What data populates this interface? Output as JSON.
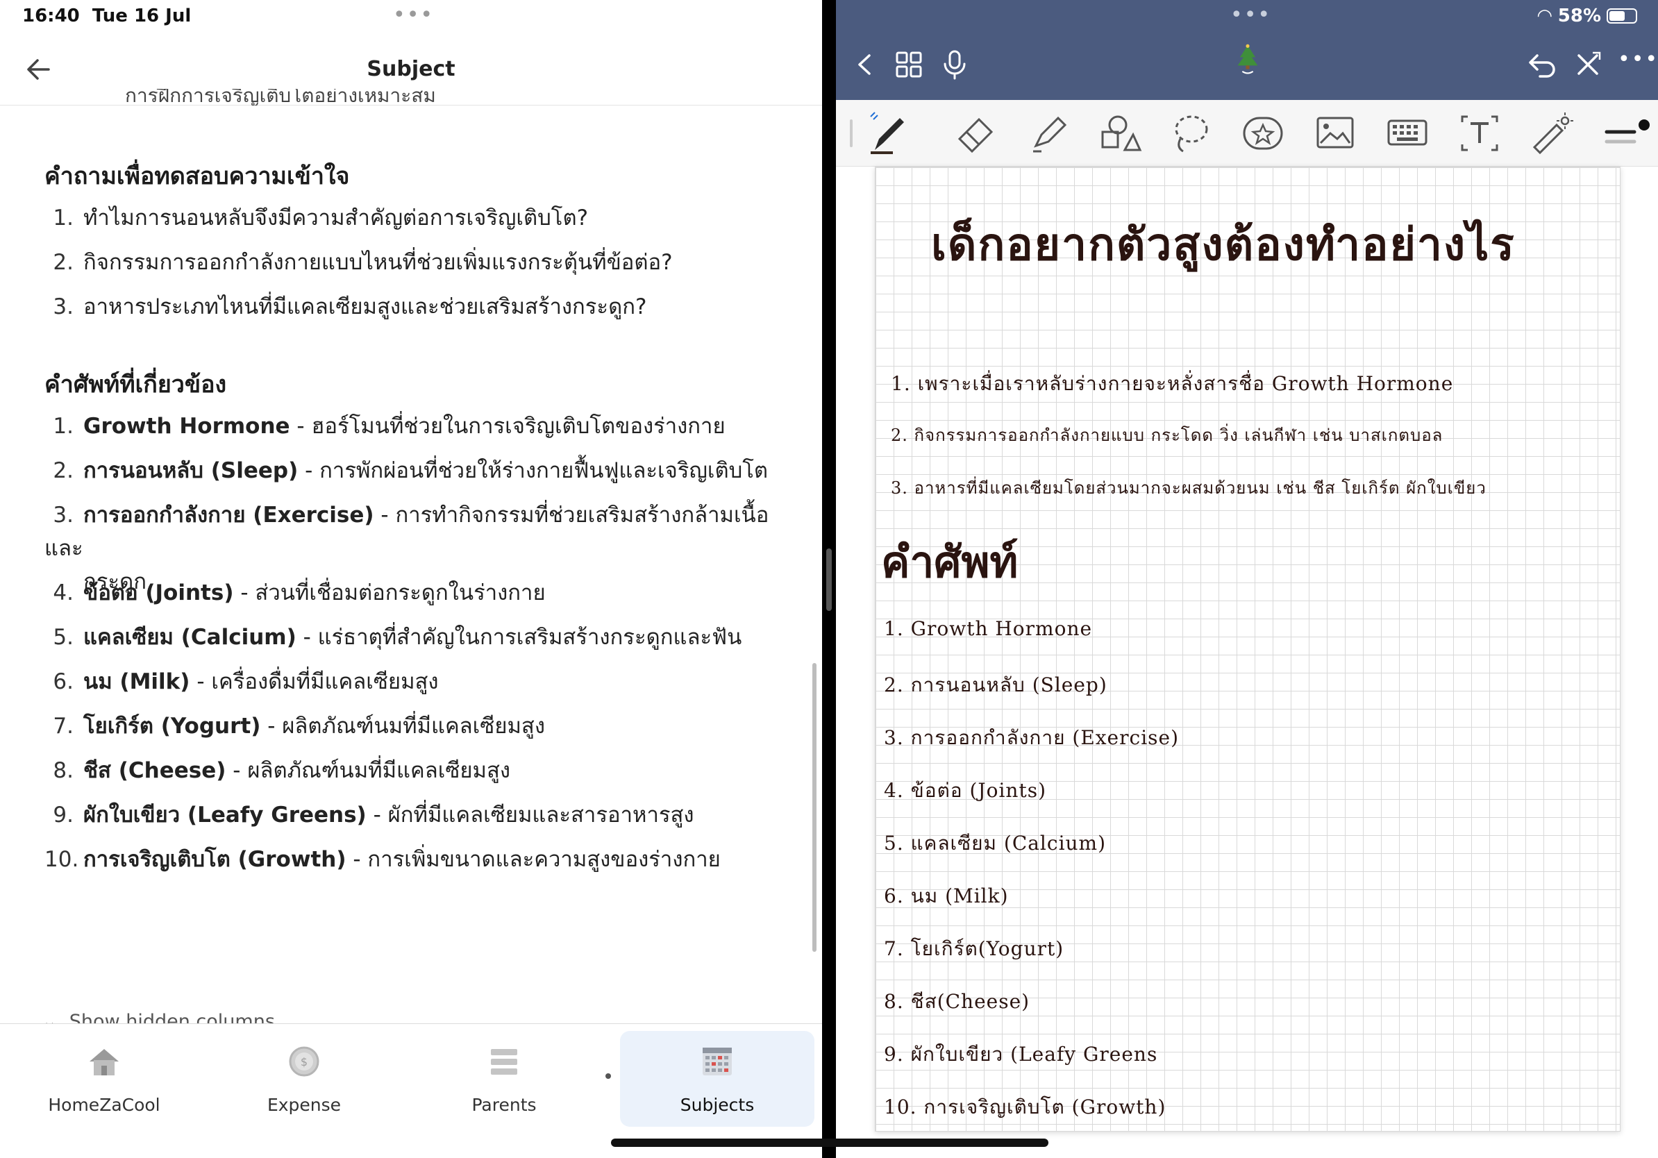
{
  "status": {
    "time": "16:40",
    "date": "Tue 16 Jul",
    "battery": "58%"
  },
  "left": {
    "header_title": "Subject",
    "cutoff_text": "การฝึกการเจริญเติบโตอย่างเหมาะสม",
    "questions_title": "คำถามเพื่อทดสอบความเข้าใจ",
    "questions": [
      {
        "num": "1.",
        "text": "ทำไมการนอนหลับจึงมีความสำคัญต่อการเจริญเติบโต?"
      },
      {
        "num": "2.",
        "text": "กิจกรรมการออกกำลังกายแบบไหนที่ช่วยเพิ่มแรงกระตุ้นที่ข้อต่อ?"
      },
      {
        "num": "3.",
        "text": "อาหารประเภทไหนที่มีแคลเซียมสูงและช่วยเสริมสร้างกระดูก?"
      }
    ],
    "terms_title": "คำศัพท์ที่เกี่ยวข้อง",
    "terms": [
      {
        "num": "1.",
        "term": "Growth Hormone",
        "desc": " - ฮอร์โมนที่ช่วยในการเจริญเติบโตของร่างกาย"
      },
      {
        "num": "2.",
        "term": "การนอนหลับ (Sleep)",
        "desc": " - การพักผ่อนที่ช่วยให้ร่างกายฟื้นฟูและเจริญเติบโต"
      },
      {
        "num": "3.",
        "term": "การออกกำลังกาย (Exercise)",
        "desc": " - การทำกิจกรรมที่ช่วยเสริมสร้างกล้ามเนื้อและ",
        "wrap": "กระดูก"
      },
      {
        "num": "4.",
        "term": "ข้อต่อ (Joints)",
        "desc": " - ส่วนที่เชื่อมต่อกระดูกในร่างกาย"
      },
      {
        "num": "5.",
        "term": "แคลเซียม (Calcium)",
        "desc": " - แร่ธาตุที่สำคัญในการเสริมสร้างกระดูกและฟัน"
      },
      {
        "num": "6.",
        "term": "นม (Milk)",
        "desc": " - เครื่องดื่มที่มีแคลเซียมสูง"
      },
      {
        "num": "7.",
        "term": "โยเกิร์ต (Yogurt)",
        "desc": " - ผลิตภัณฑ์นมที่มีแคลเซียมสูง"
      },
      {
        "num": "8.",
        "term": "ชีส (Cheese)",
        "desc": " - ผลิตภัณฑ์นมที่มีแคลเซียมสูง"
      },
      {
        "num": "9.",
        "term": "ผักใบเขียว (Leafy Greens)",
        "desc": " - ผักที่มีแคลเซียมและสารอาหารสูง"
      },
      {
        "num": "10.",
        "term": "การเจริญเติบโต (Growth)",
        "desc": " - การเพิ่มขนาดและความสูงของร่างกาย"
      }
    ],
    "show_hidden": "Show hidden columns",
    "tabs": [
      {
        "label": "HomeZaCool",
        "icon": "home-icon"
      },
      {
        "label": "Expense",
        "icon": "coin-icon"
      },
      {
        "label": "Parents",
        "icon": "list-icon"
      },
      {
        "label": "Subjects",
        "icon": "grid-calendar-icon"
      }
    ]
  },
  "right": {
    "title": "เด็กอยากตัวสูงต้องทำอย่างไร",
    "answers": [
      "1. เพราะเมื่อเราหลับร่างกายจะหลั่งสารชื่อ Growth Hormone",
      "2. กิจกรรมการออกกำลังกายแบบ  กระโดด  วิ่ง   เล่นกีฬา  เช่น  บาสเกตบอล",
      "3. อาหารที่มีแคลเซียมโดยส่วนมากจะผสมด้วยนม  เช่น  ชีส  โยเกิร์ต  ผักใบเขียว"
    ],
    "terms_heading": "คำศัพท์",
    "terms": [
      "1. Growth   Hormone",
      "2. การนอนหลับ (Sleep)",
      "3. การออกกำลังกาย (Exercise)",
      "4. ข้อต่อ (Joints)",
      "5. แคลเซียม (Calcium)",
      "6. นม (Milk)",
      "7. โยเกิร์ต(Yogurt)",
      "8. ชีส(Cheese)",
      "9. ผักใบเขียว (Leafy  Greens",
      "10. การเจริญเติบโต (Growth)"
    ]
  }
}
